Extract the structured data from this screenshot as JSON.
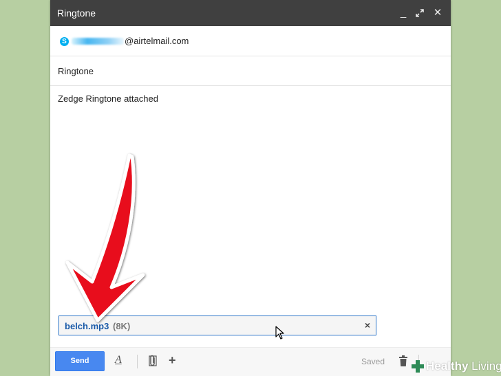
{
  "window": {
    "title": "Ringtone",
    "controls": {
      "minimize": "_",
      "popout": "⤢",
      "close": "✕"
    }
  },
  "recipient": {
    "icon": "skype-icon",
    "icon_glyph": "S",
    "email_suffix": "@airtelmail.com"
  },
  "subject": "Ringtone",
  "body_text": "Zedge Ringtone attached",
  "attachment": {
    "name": "belch.mp3",
    "size": "(8K)",
    "remove_glyph": "×"
  },
  "toolbar": {
    "send_label": "Send",
    "format_glyph": "A",
    "more_glyph": "+",
    "status": "Saved"
  },
  "logo": {
    "word1": "Healthy",
    "word2": " Living"
  },
  "colors": {
    "accent": "#4888f0",
    "annotation_arrow": "#e8111a",
    "titlebar": "#404040",
    "background": "#b7cfa2"
  }
}
